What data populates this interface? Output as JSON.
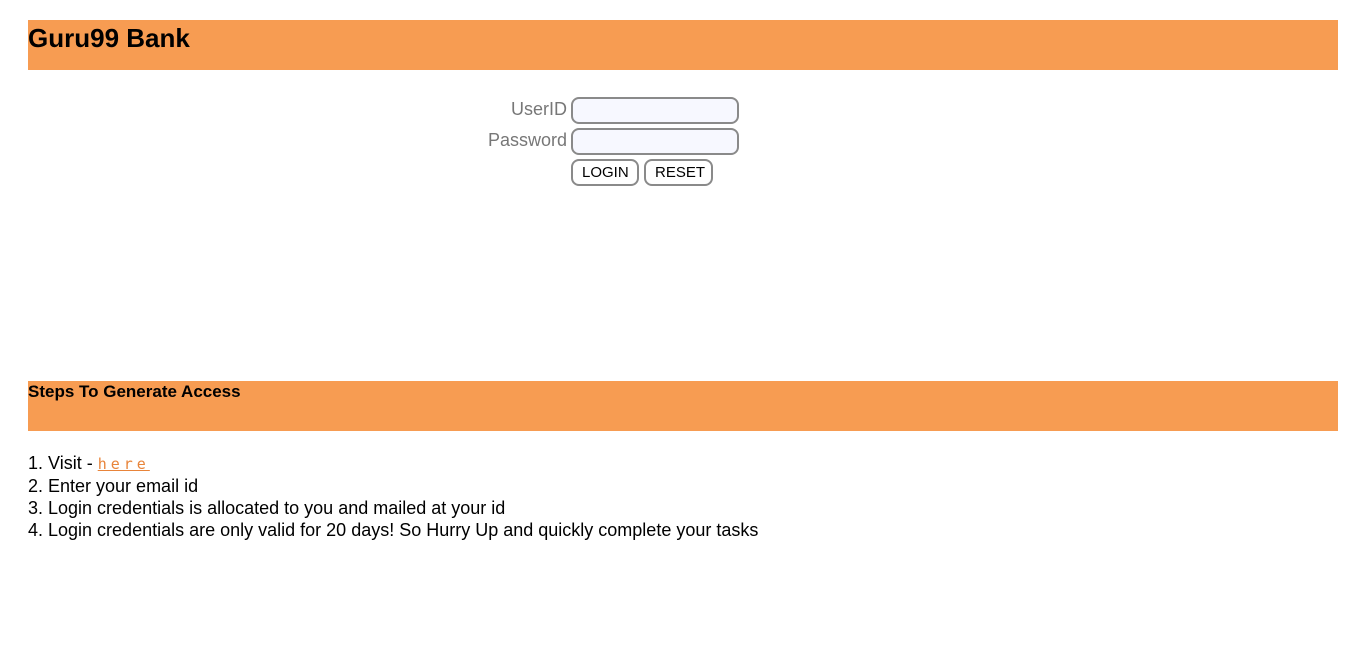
{
  "header": {
    "title": "Guru99 Bank"
  },
  "login": {
    "userid_label": "UserID",
    "userid_value": "",
    "password_label": "Password",
    "password_value": "",
    "login_button": "LOGIN",
    "reset_button": "RESET"
  },
  "steps": {
    "title": "Steps To Generate Access",
    "step1_prefix": "1. Visit - ",
    "step1_link": "here",
    "step2": "2. Enter your email id",
    "step3": "3. Login credentials is allocated to you and mailed at your id",
    "step4": "4. Login credentials are only valid for 20 days! So Hurry Up and quickly complete your tasks"
  },
  "colors": {
    "banner": "#f79c52",
    "link": "#e8843a",
    "label": "#777777",
    "input_bg": "#f7f8ff"
  }
}
